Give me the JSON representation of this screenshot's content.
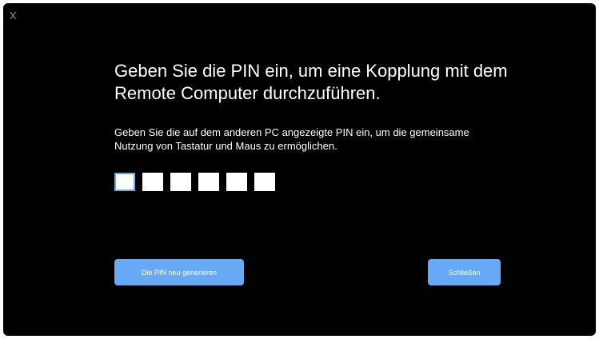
{
  "window": {
    "close_label": "X"
  },
  "dialog": {
    "title_line1": "Geben Sie die PIN ein, um eine Kopplung mit dem",
    "title_line2": "Remote Computer durchzuführen.",
    "description_line1": "Geben Sie die auf dem anderen PC angezeigte PIN ein, um die gemeinsame",
    "description_line2": "Nutzung von Tastatur und Maus zu ermöglichen.",
    "pin_digits": [
      "",
      "",
      "",
      "",
      "",
      ""
    ],
    "regenerate_button_label": "Die PIN neu generieren",
    "close_button_label": "Schließen"
  },
  "colors": {
    "background": "#000000",
    "accent": "#67a9f5",
    "text": "#ffffff"
  }
}
